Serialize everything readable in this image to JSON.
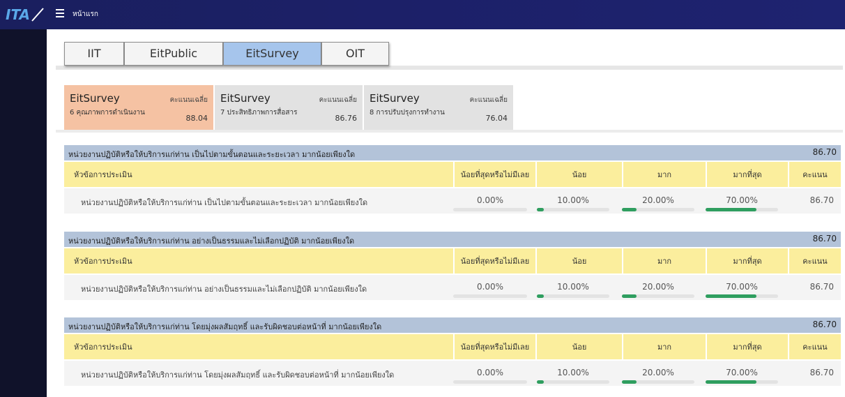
{
  "header": {
    "logo_text": "ITA",
    "breadcrumb": "หน้าแรก"
  },
  "tabs": [
    {
      "label": "IIT",
      "active": false
    },
    {
      "label": "EitPublic",
      "active": false
    },
    {
      "label": "EitSurvey",
      "active": true
    },
    {
      "label": "OIT",
      "active": false
    }
  ],
  "cards": [
    {
      "title": "EitSurvey",
      "subtitle": "6 คุณภาพการดำเนินงาน",
      "score_label": "คะแนนเฉลี่ย",
      "score": "88.04",
      "color": "#f5c2a3"
    },
    {
      "title": "EitSurvey",
      "subtitle": "7 ประสิทธิภาพการสื่อสาร",
      "score_label": "คะแนนเฉลี่ย",
      "score": "86.76",
      "color": "#e2e2e2"
    },
    {
      "title": "EitSurvey",
      "subtitle": "8 การปรับปรุงการทำงาน",
      "score_label": "คะแนนเฉลี่ย",
      "score": "76.04",
      "color": "#e2e2e2"
    }
  ],
  "columns": {
    "topic": "หัวข้อการประเมิน",
    "least": "น้อยที่สุดหรือไม่มีเลย",
    "little": "น้อย",
    "much": "มาก",
    "most": "มากที่สุด",
    "score": "คะแนน"
  },
  "sections": [
    {
      "title": "หน่วยงานปฏิบัติหรือให้บริการแก่ท่าน เป็นไปตามขั้นตอนและระยะเวลา มากน้อยเพียงใด",
      "score": "86.70",
      "row": {
        "label": "หน่วยงานปฏิบัติหรือให้บริการแก่ท่าน เป็นไปตามขั้นตอนและระยะเวลา มากน้อยเพียงใด",
        "least": "0.00%",
        "little": "10.00%",
        "much": "20.00%",
        "most": "70.00%",
        "least_value": 0,
        "little_value": 10,
        "much_value": 20,
        "most_value": 70,
        "score": "86.70"
      }
    },
    {
      "title": "หน่วยงานปฏิบัติหรือให้บริการแก่ท่าน อย่างเป็นธรรมและไม่เลือกปฏิบัติ มากน้อยเพียงใด",
      "score": "86.70",
      "row": {
        "label": "หน่วยงานปฏิบัติหรือให้บริการแก่ท่าน อย่างเป็นธรรมและไม่เลือกปฏิบัติ มากน้อยเพียงใด",
        "least": "0.00%",
        "little": "10.00%",
        "much": "20.00%",
        "most": "70.00%",
        "least_value": 0,
        "little_value": 10,
        "much_value": 20,
        "most_value": 70,
        "score": "86.70"
      }
    },
    {
      "title": "หน่วยงานปฏิบัติหรือให้บริการแก่ท่าน โดยมุ่งผลสัมฤทธิ์ และรับผิดชอบต่อหน้าที่ มากน้อยเพียงใด",
      "score": "86.70",
      "row": {
        "label": "หน่วยงานปฏิบัติหรือให้บริการแก่ท่าน โดยมุ่งผลสัมฤทธิ์ และรับผิดชอบต่อหน้าที่ มากน้อยเพียงใด",
        "least": "0.00%",
        "little": "10.00%",
        "much": "20.00%",
        "most": "70.00%",
        "least_value": 0,
        "little_value": 10,
        "much_value": 20,
        "most_value": 70,
        "score": "86.70"
      }
    }
  ]
}
